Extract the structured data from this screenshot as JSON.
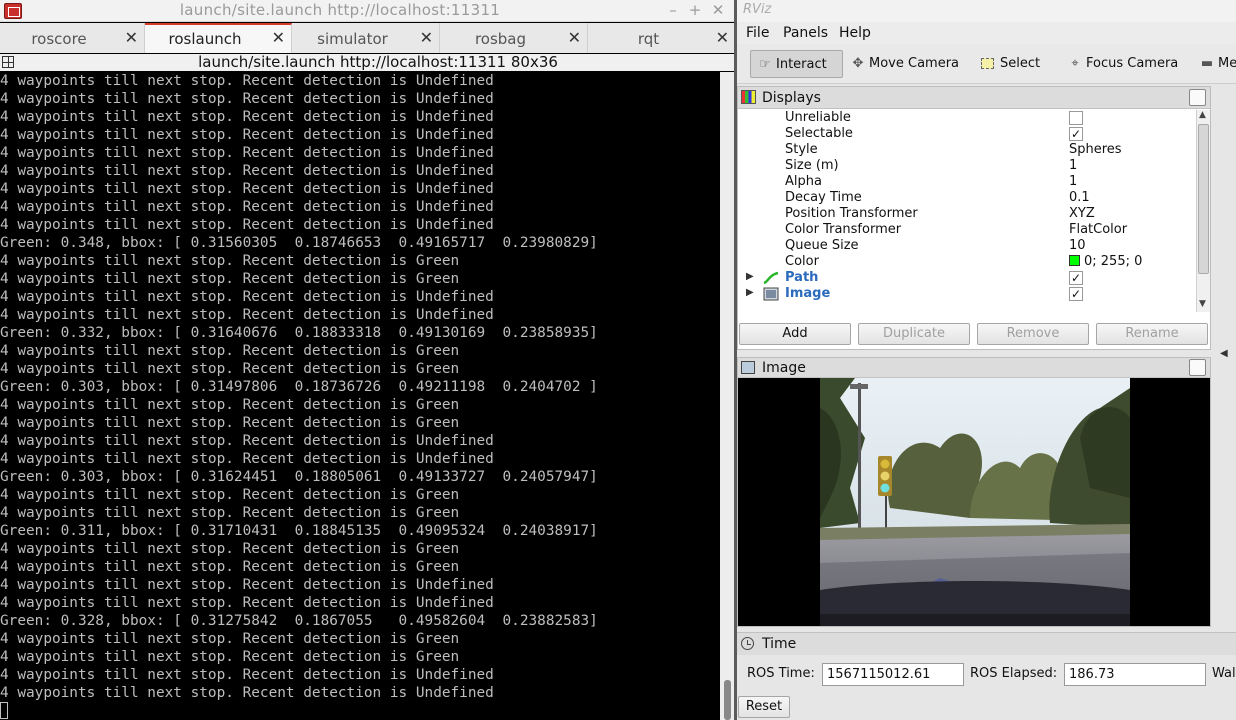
{
  "terminal": {
    "window_title": "launch/site.launch http://localhost:11311",
    "subtitle": "launch/site.launch http://localhost:11311 80x36",
    "tabs": [
      {
        "label": "roscore"
      },
      {
        "label": "roslaunch"
      },
      {
        "label": "simulator"
      },
      {
        "label": "rosbag"
      },
      {
        "label": "rqt"
      }
    ],
    "lines": [
      "4 waypoints till next stop. Recent detection is Undefined",
      "4 waypoints till next stop. Recent detection is Undefined",
      "4 waypoints till next stop. Recent detection is Undefined",
      "4 waypoints till next stop. Recent detection is Undefined",
      "4 waypoints till next stop. Recent detection is Undefined",
      "4 waypoints till next stop. Recent detection is Undefined",
      "4 waypoints till next stop. Recent detection is Undefined",
      "4 waypoints till next stop. Recent detection is Undefined",
      "4 waypoints till next stop. Recent detection is Undefined",
      "Green: 0.348, bbox: [ 0.31560305  0.18746653  0.49165717  0.23980829]",
      "4 waypoints till next stop. Recent detection is Green",
      "4 waypoints till next stop. Recent detection is Green",
      "4 waypoints till next stop. Recent detection is Undefined",
      "4 waypoints till next stop. Recent detection is Undefined",
      "Green: 0.332, bbox: [ 0.31640676  0.18833318  0.49130169  0.23858935]",
      "4 waypoints till next stop. Recent detection is Green",
      "4 waypoints till next stop. Recent detection is Green",
      "Green: 0.303, bbox: [ 0.31497806  0.18736726  0.49211198  0.2404702 ]",
      "4 waypoints till next stop. Recent detection is Green",
      "4 waypoints till next stop. Recent detection is Green",
      "4 waypoints till next stop. Recent detection is Undefined",
      "4 waypoints till next stop. Recent detection is Undefined",
      "Green: 0.303, bbox: [ 0.31624451  0.18805061  0.49133727  0.24057947]",
      "4 waypoints till next stop. Recent detection is Green",
      "4 waypoints till next stop. Recent detection is Green",
      "Green: 0.311, bbox: [ 0.31710431  0.18845135  0.49095324  0.24038917]",
      "4 waypoints till next stop. Recent detection is Green",
      "4 waypoints till next stop. Recent detection is Green",
      "4 waypoints till next stop. Recent detection is Undefined",
      "4 waypoints till next stop. Recent detection is Undefined",
      "Green: 0.328, bbox: [ 0.31275842  0.1867055   0.49582604  0.23882583]",
      "4 waypoints till next stop. Recent detection is Green",
      "4 waypoints till next stop. Recent detection is Green",
      "4 waypoints till next stop. Recent detection is Undefined",
      "4 waypoints till next stop. Recent detection is Undefined"
    ]
  },
  "rviz": {
    "window_title": "RViz",
    "menu": {
      "file": "File",
      "panels": "Panels",
      "help": "Help"
    },
    "toolbar": {
      "interact": "Interact",
      "move_camera": "Move Camera",
      "select": "Select",
      "focus_camera": "Focus Camera",
      "measure": "Measure"
    },
    "displays": {
      "title": "Displays",
      "properties": [
        {
          "name": "Unreliable",
          "type": "check",
          "checked": false
        },
        {
          "name": "Selectable",
          "type": "check",
          "checked": true
        },
        {
          "name": "Style",
          "value": "Spheres"
        },
        {
          "name": "Size (m)",
          "value": "1"
        },
        {
          "name": "Alpha",
          "value": "1"
        },
        {
          "name": "Decay Time",
          "value": "0.1"
        },
        {
          "name": "Position Transformer",
          "value": "XYZ"
        },
        {
          "name": "Color Transformer",
          "value": "FlatColor"
        },
        {
          "name": "Queue Size",
          "value": "10"
        },
        {
          "name": "Color",
          "value": "0; 255; 0",
          "swatch": "#00ff00"
        }
      ],
      "display_items": [
        {
          "name": "Path",
          "checked": true,
          "icon": "path-icon"
        },
        {
          "name": "Image",
          "checked": true,
          "icon": "image-icon"
        }
      ],
      "buttons": {
        "add": "Add",
        "duplicate": "Duplicate",
        "remove": "Remove",
        "rename": "Rename"
      }
    },
    "image_panel": {
      "title": "Image"
    },
    "time": {
      "title": "Time",
      "ros_time_label": "ROS Time:",
      "ros_time_value": "1567115012.61",
      "ros_elapsed_label": "ROS Elapsed:",
      "ros_elapsed_value": "186.73",
      "wall_label": "Wall",
      "reset": "Reset"
    }
  }
}
